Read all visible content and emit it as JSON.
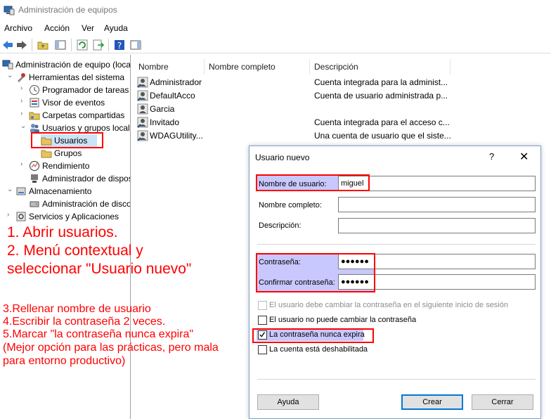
{
  "window": {
    "title": "Administración de equipos"
  },
  "menu": [
    "Archivo",
    "Acción",
    "Ver",
    "Ayuda"
  ],
  "tree": {
    "root": "Administración de equipo (local)",
    "system_tools": "Herramientas del sistema",
    "task_scheduler": "Programador de tareas",
    "event_viewer": "Visor de eventos",
    "shared_folders": "Carpetas compartidas",
    "local_users_groups": "Usuarios y grupos locales",
    "users": "Usuarios",
    "groups": "Grupos",
    "performance": "Rendimiento",
    "device_manager": "Administrador de dispositivos",
    "storage": "Almacenamiento",
    "disk_management": "Administración de discos",
    "services_apps": "Servicios y Aplicaciones"
  },
  "list": {
    "columns": [
      "Nombre",
      "Nombre completo",
      "Descripción"
    ],
    "rows": [
      {
        "name": "Administrador",
        "desc": "Cuenta integrada para la administ..."
      },
      {
        "name": "DefaultAcco",
        "desc": "Cuenta de usuario administrada p..."
      },
      {
        "name": "Garcia",
        "desc": ""
      },
      {
        "name": "Invitado",
        "desc": "Cuenta integrada para el acceso c..."
      },
      {
        "name": "WDAGUtility...",
        "desc": "Una cuenta de usuario que el siste..."
      }
    ]
  },
  "annotations": {
    "big": [
      "1. Abrir usuarios.",
      "2. Menú contextual y",
      "seleccionar \"Usuario nuevo\""
    ],
    "small": [
      "3.Rellenar nombre de usuario",
      "4.Escribir la contraseña 2 veces.",
      "5.Marcar \"la contraseña nunca expira\"",
      "(Mejor opción para las prácticas, pero mala",
      "para entorno productivo)"
    ]
  },
  "dialog": {
    "title": "Usuario nuevo",
    "help": "?",
    "close": "✕",
    "username_label": "Nombre de usuario:",
    "username_value": "miguel",
    "fullname_label": "Nombre completo:",
    "fullname_value": "",
    "description_label": "Descripción:",
    "description_value": "",
    "password_label": "Contraseña:",
    "password_value": "●●●●●●",
    "confirm_label": "Confirmar contraseña:",
    "confirm_value": "●●●●●●",
    "chk_must_change": "El usuario debe cambiar la contraseña en el siguiente inicio de sesión",
    "chk_cannot_change": "El usuario no puede cambiar la contraseña",
    "chk_never_expires": "La contraseña nunca expira",
    "chk_disabled": "La cuenta está deshabilitada",
    "btn_help": "Ayuda",
    "btn_create": "Crear",
    "btn_close": "Cerrar"
  }
}
